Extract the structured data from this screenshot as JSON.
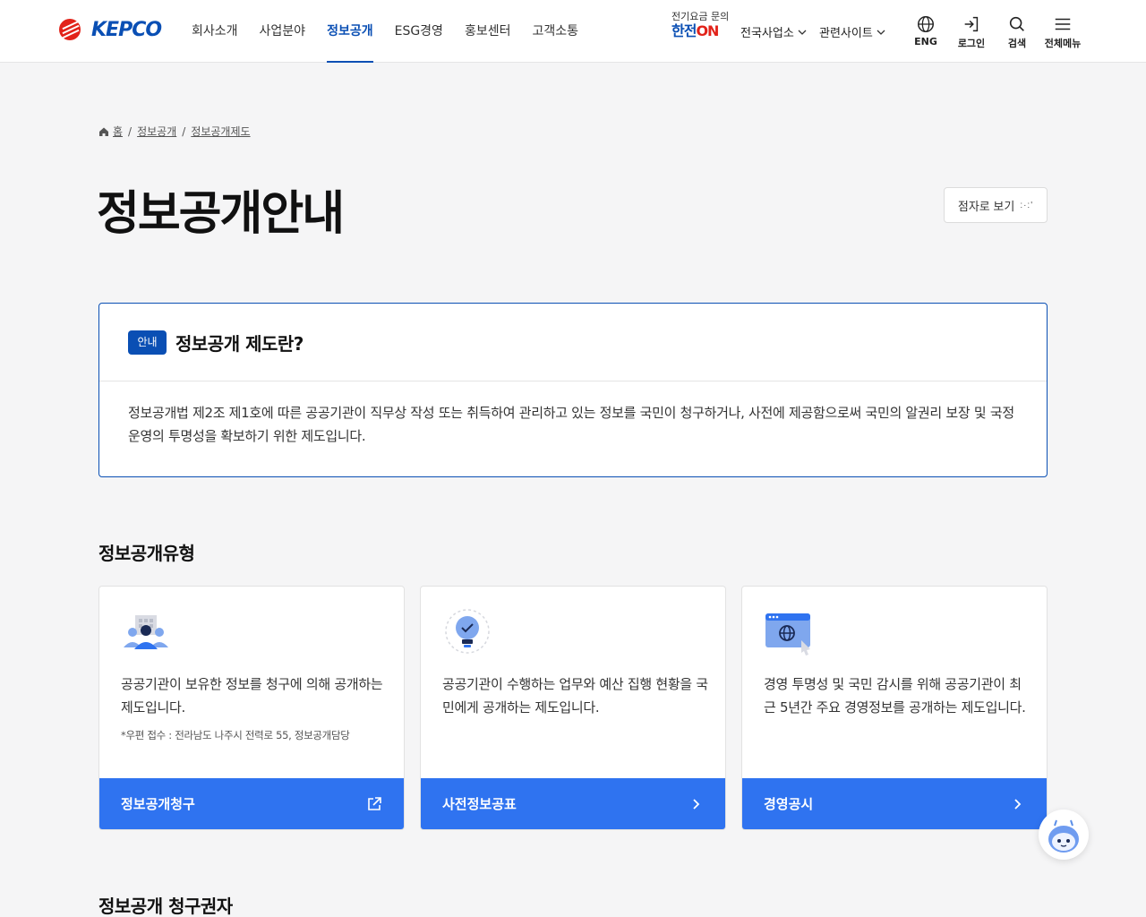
{
  "header": {
    "logo_text": "KEPCO",
    "nav": [
      "회사소개",
      "사업분야",
      "정보공개",
      "ESG경영",
      "홍보센터",
      "고객소통"
    ],
    "active_nav": "정보공개",
    "hanjeon_small": "전기요금 문의",
    "hanjeon_brand": "한전",
    "hanjeon_on": "ON",
    "dropdown_1": "전국사업소",
    "dropdown_2": "관련사이트",
    "util": {
      "eng": "ENG",
      "login": "로그인",
      "search": "검색",
      "menu": "전체메뉴"
    }
  },
  "breadcrumb": {
    "home": "홈",
    "level1": "정보공개",
    "level2": "정보공개제도",
    "sep": "/"
  },
  "page": {
    "title": "정보공개안내",
    "braille_label": "점자로 보기",
    "braille_dots": ":·:'"
  },
  "info": {
    "badge": "안내",
    "title": "정보공개 제도란?",
    "body": "정보공개법 제2조 제1호에 따른 공공기관이 직무상 작성 또는 취득하여 관리하고 있는 정보를 국민이 청구하거나, 사전에 제공함으로써 국민의 알권리 보장 및 국정운영의 투명성을 확보하기 위한 제도입니다."
  },
  "types_section": {
    "title": "정보공개유형"
  },
  "cards": [
    {
      "icon": "people-building-icon",
      "desc": "공공기관이 보유한 정보를 청구에 의해 공개하는 제도입니다.",
      "note": "*우편 접수 : 전라남도 나주시 전력로 55, 정보공개담당",
      "button": "정보공개청구",
      "button_icon": "external-link-icon"
    },
    {
      "icon": "lightbulb-check-icon",
      "desc": "공공기관이 수행하는 업무와 예산 집행 현황을 국민에게 공개하는 제도입니다.",
      "note": "",
      "button": "사전정보공표",
      "button_icon": "chevron-right-icon"
    },
    {
      "icon": "browser-globe-icon",
      "desc": "경영 투명성 및 국민 감시를 위해 공공기관이 최근 5년간 주요 경영정보를 공개하는 제도입니다.",
      "note": "",
      "button": "경영공시",
      "button_icon": "chevron-right-icon"
    }
  ],
  "requester_section": {
    "title": "정보공개 청구권자"
  },
  "colors": {
    "primary": "#0a4fb4",
    "card_button": "#2f73f0",
    "logo_red": "#e2231a"
  }
}
